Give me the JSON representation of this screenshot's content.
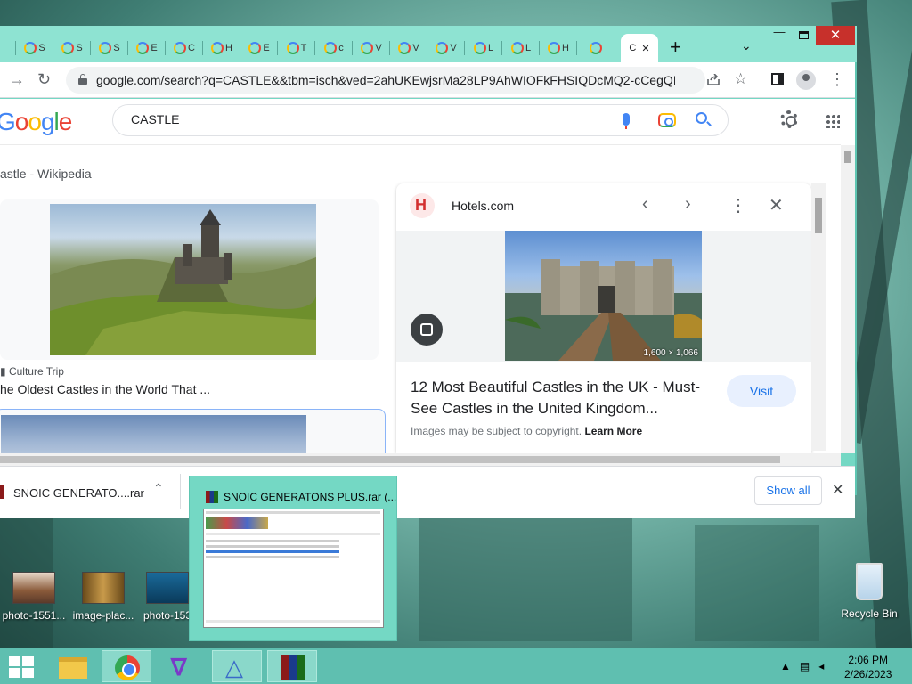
{
  "browser": {
    "tabs": [
      "S",
      "S",
      "S",
      "E",
      "C",
      "H",
      "E",
      "T",
      "c",
      "V",
      "V",
      "V",
      "L",
      "L",
      "H"
    ],
    "active_tab": "C",
    "close_glyph": "✕",
    "new_tab": "+",
    "url": "google.com/search?q=CASTLE&&tbm=isch&ved=2ahUKEwjsrMa28LP9AhWIOFkFHSIQDcMQ2-cCegQIABA..."
  },
  "search": {
    "logo": "Google",
    "query": "CASTLE"
  },
  "results": {
    "wiki_snippet": "astle - Wikipedia",
    "card1_source": "Culture Trip",
    "card1_title": "he Oldest Castles in the World That ..."
  },
  "panel": {
    "site": "Hotels.com",
    "dimensions": "1,600 × 1,066",
    "title": "12 Most Beautiful Castles in the UK - Must-See Castles in the United Kingdom...",
    "visit": "Visit",
    "copyright": "Images may be subject to copyright.",
    "learn_more": "Learn More"
  },
  "downloads": {
    "file": "SNOIC GENERATO....rar",
    "show_all": "Show all"
  },
  "preview": {
    "title": "SNOIC GENERATONS PLUS.rar (..."
  },
  "desktop": {
    "icons": [
      "photo-1551...",
      "image-plac...",
      "photo-153"
    ],
    "recycle": "Recycle Bin"
  },
  "taskbar": {
    "time": "2:06 PM",
    "date": "2/26/2023"
  },
  "colors": {
    "window_frame": "#74d8c4",
    "taskbar": "#5fbfb0",
    "accent_blue": "#1a73e8",
    "close_red": "#c7302b"
  }
}
